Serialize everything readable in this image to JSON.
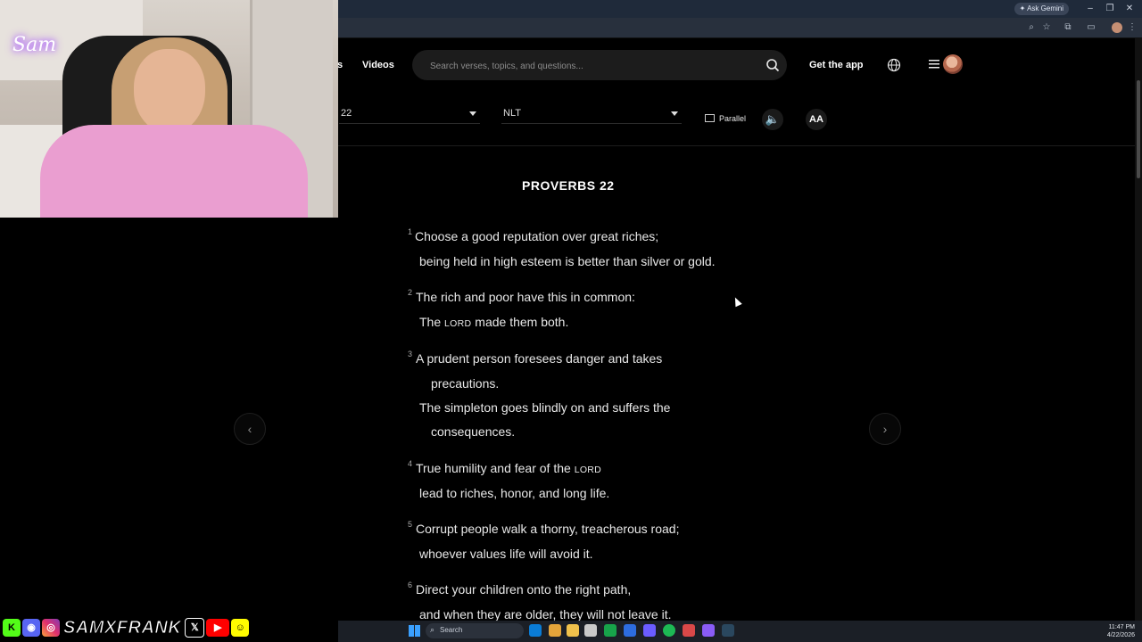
{
  "browser": {
    "gemini_label": "Ask Gemini"
  },
  "header": {
    "nav_partial": "s",
    "nav_videos": "Videos",
    "search_placeholder": "Search verses, topics, and questions...",
    "get_app": "Get the app"
  },
  "toolbar": {
    "chapter_select": "22",
    "version_select": "NLT",
    "parallel": "Parallel",
    "text_size": "AA"
  },
  "reader": {
    "chapter_title": "PROVERBS 22",
    "verses": [
      {
        "num": "1",
        "l1": "Choose a good reputation over great riches;",
        "l2": "being held in high esteem is better than silver or gold."
      },
      {
        "num": "2",
        "l1": "The rich and poor have this in common:",
        "l2a": "The ",
        "l2sc": "Lord",
        "l2b": " made them both."
      },
      {
        "num": "3",
        "l1": "A prudent person foresees danger and takes",
        "l1c": "precautions.",
        "l2": "The simpleton goes blindly on and suffers the",
        "l2c": "consequences."
      },
      {
        "num": "4",
        "l1a": "True humility and fear of the ",
        "l1sc": "Lord",
        "l2": "lead to riches, honor, and long life."
      },
      {
        "num": "5",
        "l1": "Corrupt people walk a thorny, treacherous road;",
        "l2": "whoever values life will avoid it."
      },
      {
        "num": "6",
        "l1": "Direct your children onto the right path,",
        "l2": "and when they are older, they will not leave it."
      }
    ]
  },
  "overlay": {
    "cam_logo": "Sam",
    "social_handle": "SAMXFRANK"
  },
  "taskbar": {
    "search": "Search",
    "time": "11:47 PM",
    "date": "4/22/2026"
  },
  "colors": {
    "page_bg": "#000000",
    "search_bg": "#1c1c1c",
    "browser_frame": "#1f2a3a"
  }
}
